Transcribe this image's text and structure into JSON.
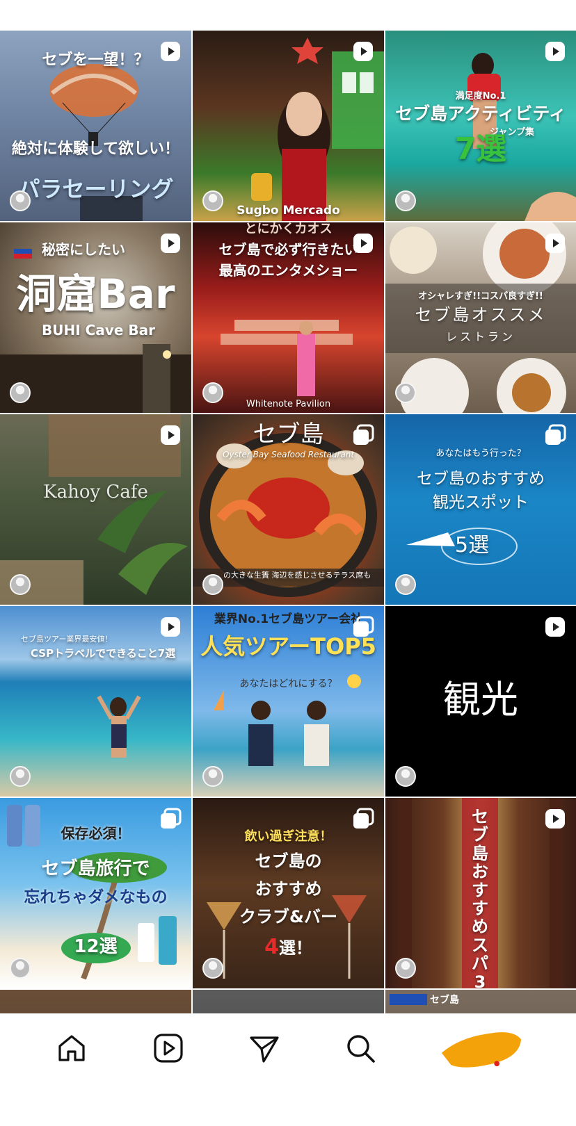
{
  "tiles": [
    {
      "lines": [
        "セブを一望！？",
        "絶対に体験して欲しい！",
        "パラセーリング"
      ]
    },
    {
      "lines": [
        "Sugbo Mercado"
      ]
    },
    {
      "lines": [
        "満足度No.1",
        "セブ島アクティビティ",
        "ジャンプ集",
        "7選"
      ]
    },
    {
      "lines": [
        "秘密にしたい",
        "洞窟Bar",
        "BUHI Cave Bar"
      ]
    },
    {
      "lines": [
        "とにかくカオス",
        "セブ島で必ず行きたい",
        "最高のエンタメショー",
        "Whitenote Pavilion"
      ]
    },
    {
      "lines": [
        "オシャレすぎ!!コスパ良すぎ!!",
        "セブ島オススメ",
        "レストラン"
      ]
    },
    {
      "lines": [
        "Kahoy Cafe"
      ]
    },
    {
      "lines": [
        "セブ島",
        "Oyster Bay Seafood Restaurant",
        "の大きな生簀 海辺を感じさせるテラス席も"
      ]
    },
    {
      "lines": [
        "あなたはもう行った？",
        "セブ島のおすすめ",
        "観光スポット",
        "5選"
      ]
    },
    {
      "lines": [
        "セブ島ツアー業界最安値！",
        "CSPトラベルでできること7選"
      ]
    },
    {
      "lines": [
        "業界No.1セブ島ツアー会社",
        "人気ツアーTOP5",
        "あなたはどれにする？"
      ]
    },
    {
      "lines": [
        "観光"
      ]
    },
    {
      "lines": [
        "保存必須！",
        "セブ島旅行で",
        "忘れちゃダメなもの",
        "12選"
      ]
    },
    {
      "lines": [
        "飲い過ぎ注意！",
        "セブ島の",
        "おすすめ",
        "クラブ&バー",
        "4",
        "選！"
      ]
    },
    {
      "lines": [
        "セブ島おすすめスパ3選"
      ]
    }
  ],
  "partial_tiles": [
    {
      "label": "セブ島"
    }
  ],
  "nav": {
    "items": [
      "home-icon",
      "reels-icon",
      "send-icon",
      "search-icon",
      "profile-avatar"
    ],
    "profile_color": "#f4a20a"
  }
}
